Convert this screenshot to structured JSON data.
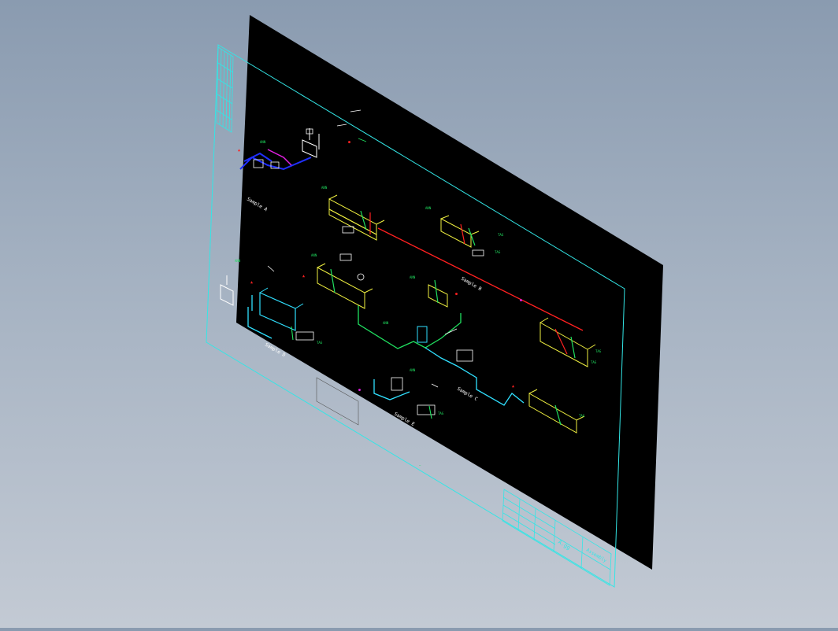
{
  "viewer": {
    "background_top": "#8a9bb0",
    "background_bottom": "#c3cad4"
  },
  "drawing": {
    "sheet_color": "#000000",
    "frame_color": "#33e6e6",
    "colors": {
      "pipe_red": "#ff2020",
      "pipe_green": "#20e060",
      "pipe_cyan": "#30e0ff",
      "pipe_blue": "#2030ff",
      "pipe_magenta": "#e020e0",
      "equipment_yellow": "#f0f040",
      "line_white": "#ffffff"
    },
    "view_labels": [
      {
        "id": "label-view-1",
        "text": "Sample A"
      },
      {
        "id": "label-view-2",
        "text": "Sample B"
      },
      {
        "id": "label-view-3",
        "text": "Sample C"
      },
      {
        "id": "label-view-4",
        "text": "Sample D"
      },
      {
        "id": "label-view-5",
        "text": "Sample E"
      }
    ],
    "title_block": {
      "name_text": "A.gg",
      "sub_text": "Assembly"
    }
  }
}
